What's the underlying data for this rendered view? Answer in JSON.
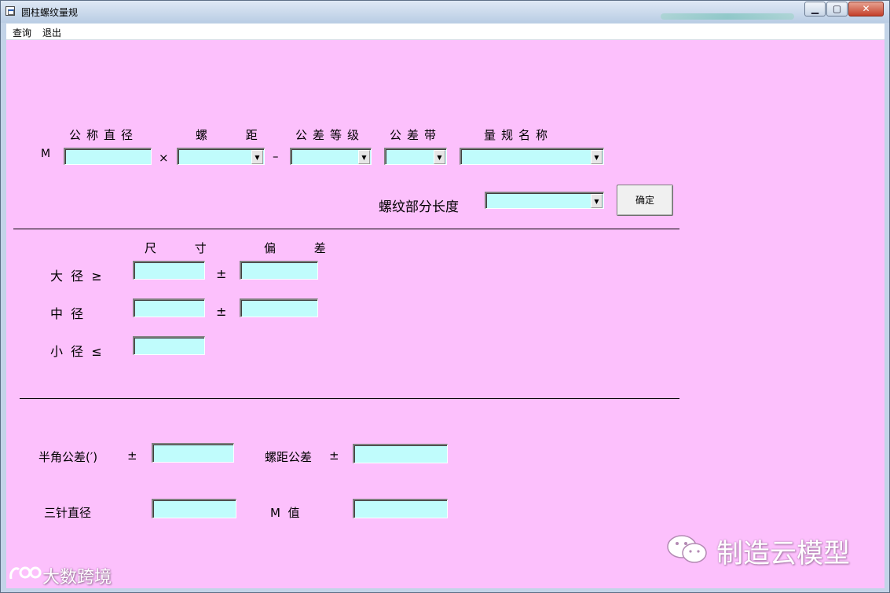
{
  "window": {
    "title": "圆柱螺纹量规",
    "min_symbol": "▁",
    "max_symbol": "▢",
    "close_symbol": "✕"
  },
  "menu": {
    "items": [
      {
        "label": "查询"
      },
      {
        "label": "退出"
      }
    ]
  },
  "thread_spec": {
    "prefix": "M",
    "headers": {
      "nominal_diameter": "公称直径",
      "pitch": "螺 距",
      "tolerance_grade": "公差等级",
      "tolerance_zone": "公差带",
      "gauge_name": "量规名称"
    },
    "times_sign": "×",
    "dash_sign": "–",
    "nominal_diameter_value": "",
    "pitch_value": "",
    "tolerance_grade_value": "",
    "tolerance_zone_value": "",
    "gauge_name_value": ""
  },
  "thread_length": {
    "label": "螺纹部分长度",
    "value": ""
  },
  "ok_button": {
    "label": "确定"
  },
  "dimensions": {
    "headers": {
      "size": "尺 寸",
      "deviation": "偏 差"
    },
    "pm_sign": "±",
    "major": {
      "label": "大  径  ≥",
      "size": "",
      "deviation": ""
    },
    "pitch_diameter": {
      "label": "中  径",
      "size": "",
      "deviation": ""
    },
    "minor": {
      "label": "小  径  ≤",
      "size": ""
    }
  },
  "tolerances": {
    "half_angle": {
      "label": "半角公差(′)",
      "pm": "±",
      "value": ""
    },
    "pitch_tol": {
      "label": "螺距公差",
      "pm": "±",
      "value": ""
    },
    "three_wire": {
      "label": "三针直径",
      "value": ""
    },
    "m_value": {
      "label": "M  值",
      "value": ""
    }
  },
  "watermarks": {
    "brand": "制造云模型",
    "corner": "大数跨境"
  },
  "colors": {
    "client_bg": "#fcc0fc",
    "field_bg": "#c0fcfc"
  }
}
